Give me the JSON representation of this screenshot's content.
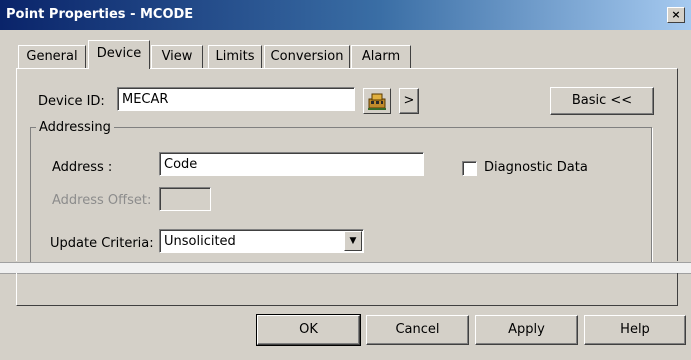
{
  "window": {
    "title": "Point Properties - MCODE",
    "close_glyph": "×"
  },
  "tabs": [
    {
      "label": "General"
    },
    {
      "label": "Device",
      "active": true
    },
    {
      "label": "View"
    },
    {
      "label": "Limits"
    },
    {
      "label": "Conversion"
    },
    {
      "label": "Alarm"
    }
  ],
  "device": {
    "id_label": "Device ID:",
    "id_value": "MECAR",
    "browse_icon": "device-browse-icon",
    "more_label": ">",
    "basic_label": "Basic <<"
  },
  "addressing": {
    "group_label": "Addressing",
    "address_label": "Address :",
    "address_value": "Code",
    "offset_label": "Address Offset:",
    "offset_value": "",
    "diagnostic_label": "Diagnostic Data",
    "diagnostic_checked": false,
    "update_label": "Update Criteria:",
    "update_value": "Unsolicited"
  },
  "footer": {
    "ok_label": "OK",
    "cancel_label": "Cancel",
    "apply_label": "Apply",
    "help_label": "Help"
  }
}
